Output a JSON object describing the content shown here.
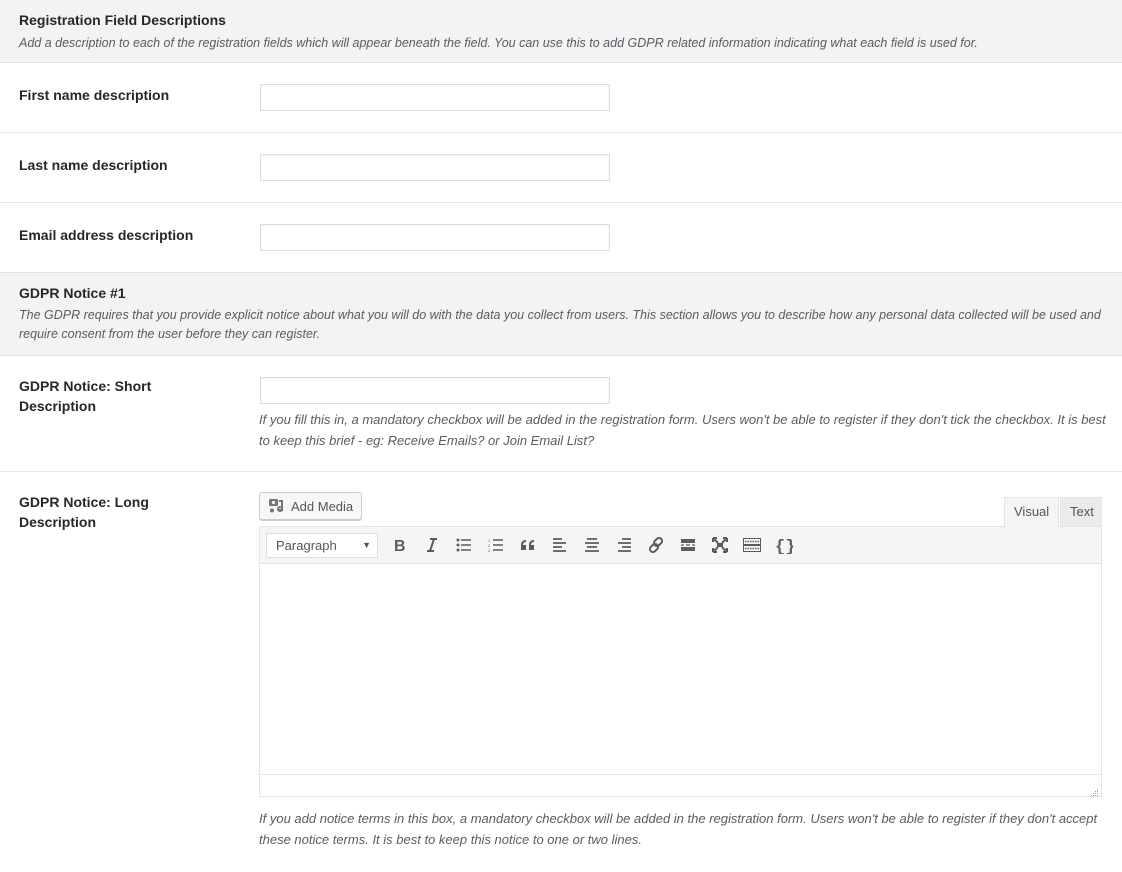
{
  "registration_section": {
    "title": "Registration Field Descriptions",
    "description": "Add a description to each of the registration fields which will appear beneath the field. You can use this to add GDPR related information indicating what each field is used for.",
    "fields": [
      {
        "label": "First name description",
        "value": ""
      },
      {
        "label": "Last name description",
        "value": ""
      },
      {
        "label": "Email address description",
        "value": ""
      }
    ]
  },
  "gdpr_section": {
    "title": "GDPR Notice #1",
    "description": "The GDPR requires that you provide explicit notice about what you will do with the data you collect from users. This section allows you to describe how any personal data collected will be used and require consent from the user before they can register.",
    "short_description": {
      "label": "GDPR Notice: Short Description",
      "value": "",
      "help": "If you fill this in, a mandatory checkbox will be added in the registration form. Users won't be able to register if they don't tick the checkbox. It is best to keep this brief - eg: Receive Emails? or Join Email List?"
    },
    "long_description": {
      "label": "GDPR Notice: Long Description",
      "add_media_label": "Add Media",
      "tabs": [
        "Visual",
        "Text"
      ],
      "active_tab": "Visual",
      "format_select": "Paragraph",
      "toolbar_buttons": [
        "bold",
        "italic",
        "bulleted-list",
        "numbered-list",
        "blockquote",
        "align-left",
        "align-center",
        "align-right",
        "insert-link",
        "read-more",
        "fullscreen",
        "toolbar-toggle",
        "shortcode"
      ],
      "content": "",
      "help": "If you add notice terms in this box, a mandatory checkbox will be added in the registration form. Users won't be able to register if they don't accept these notice terms. It is best to keep this notice to one or two lines."
    }
  }
}
